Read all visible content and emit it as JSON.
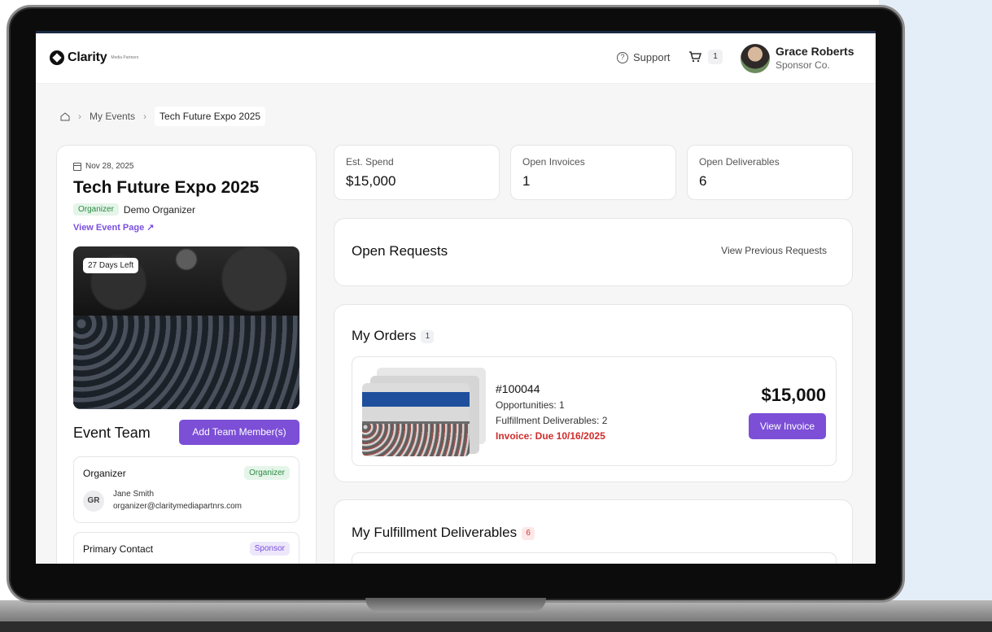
{
  "header": {
    "logo_text": "Clarity",
    "logo_sub": "Media Partners",
    "support_label": "Support",
    "cart_count": "1",
    "user_name": "Grace Roberts",
    "user_org": "Sponsor Co."
  },
  "breadcrumb": {
    "items": [
      "My Events",
      "Tech Future Expo 2025"
    ]
  },
  "event": {
    "date": "Nov 28, 2025",
    "title": "Tech Future Expo 2025",
    "organizer_role": "Organizer",
    "organizer_name": "Demo Organizer",
    "view_page_label": "View Event Page",
    "days_left": "27 Days Left"
  },
  "team": {
    "title": "Event Team",
    "add_button": "Add Team Member(s)",
    "members": [
      {
        "role": "Organizer",
        "badge": "Organizer",
        "initials": "GR",
        "name": "Jane Smith",
        "email": "organizer@claritymediapartnrs.com"
      },
      {
        "role": "Primary Contact",
        "badge": "Sponsor"
      }
    ]
  },
  "stats": [
    {
      "label": "Est. Spend",
      "value": "$15,000"
    },
    {
      "label": "Open Invoices",
      "value": "1"
    },
    {
      "label": "Open Deliverables",
      "value": "6"
    }
  ],
  "requests": {
    "title": "Open Requests",
    "view_previous": "View Previous Requests"
  },
  "orders": {
    "title": "My Orders",
    "count": "1",
    "order_number": "#100044",
    "opportunities": "Opportunities: 1",
    "deliverables": "Fulfillment Deliverables: 2",
    "invoice_due": "Invoice: Due 10/16/2025",
    "total": "$15,000",
    "view_invoice": "View Invoice"
  },
  "fulfillment": {
    "title": "My Fulfillment Deliverables",
    "count": "6"
  },
  "colors": {
    "accent": "#7c4fd6",
    "danger": "#d02c2c",
    "success_bg": "#e5f5e9"
  }
}
